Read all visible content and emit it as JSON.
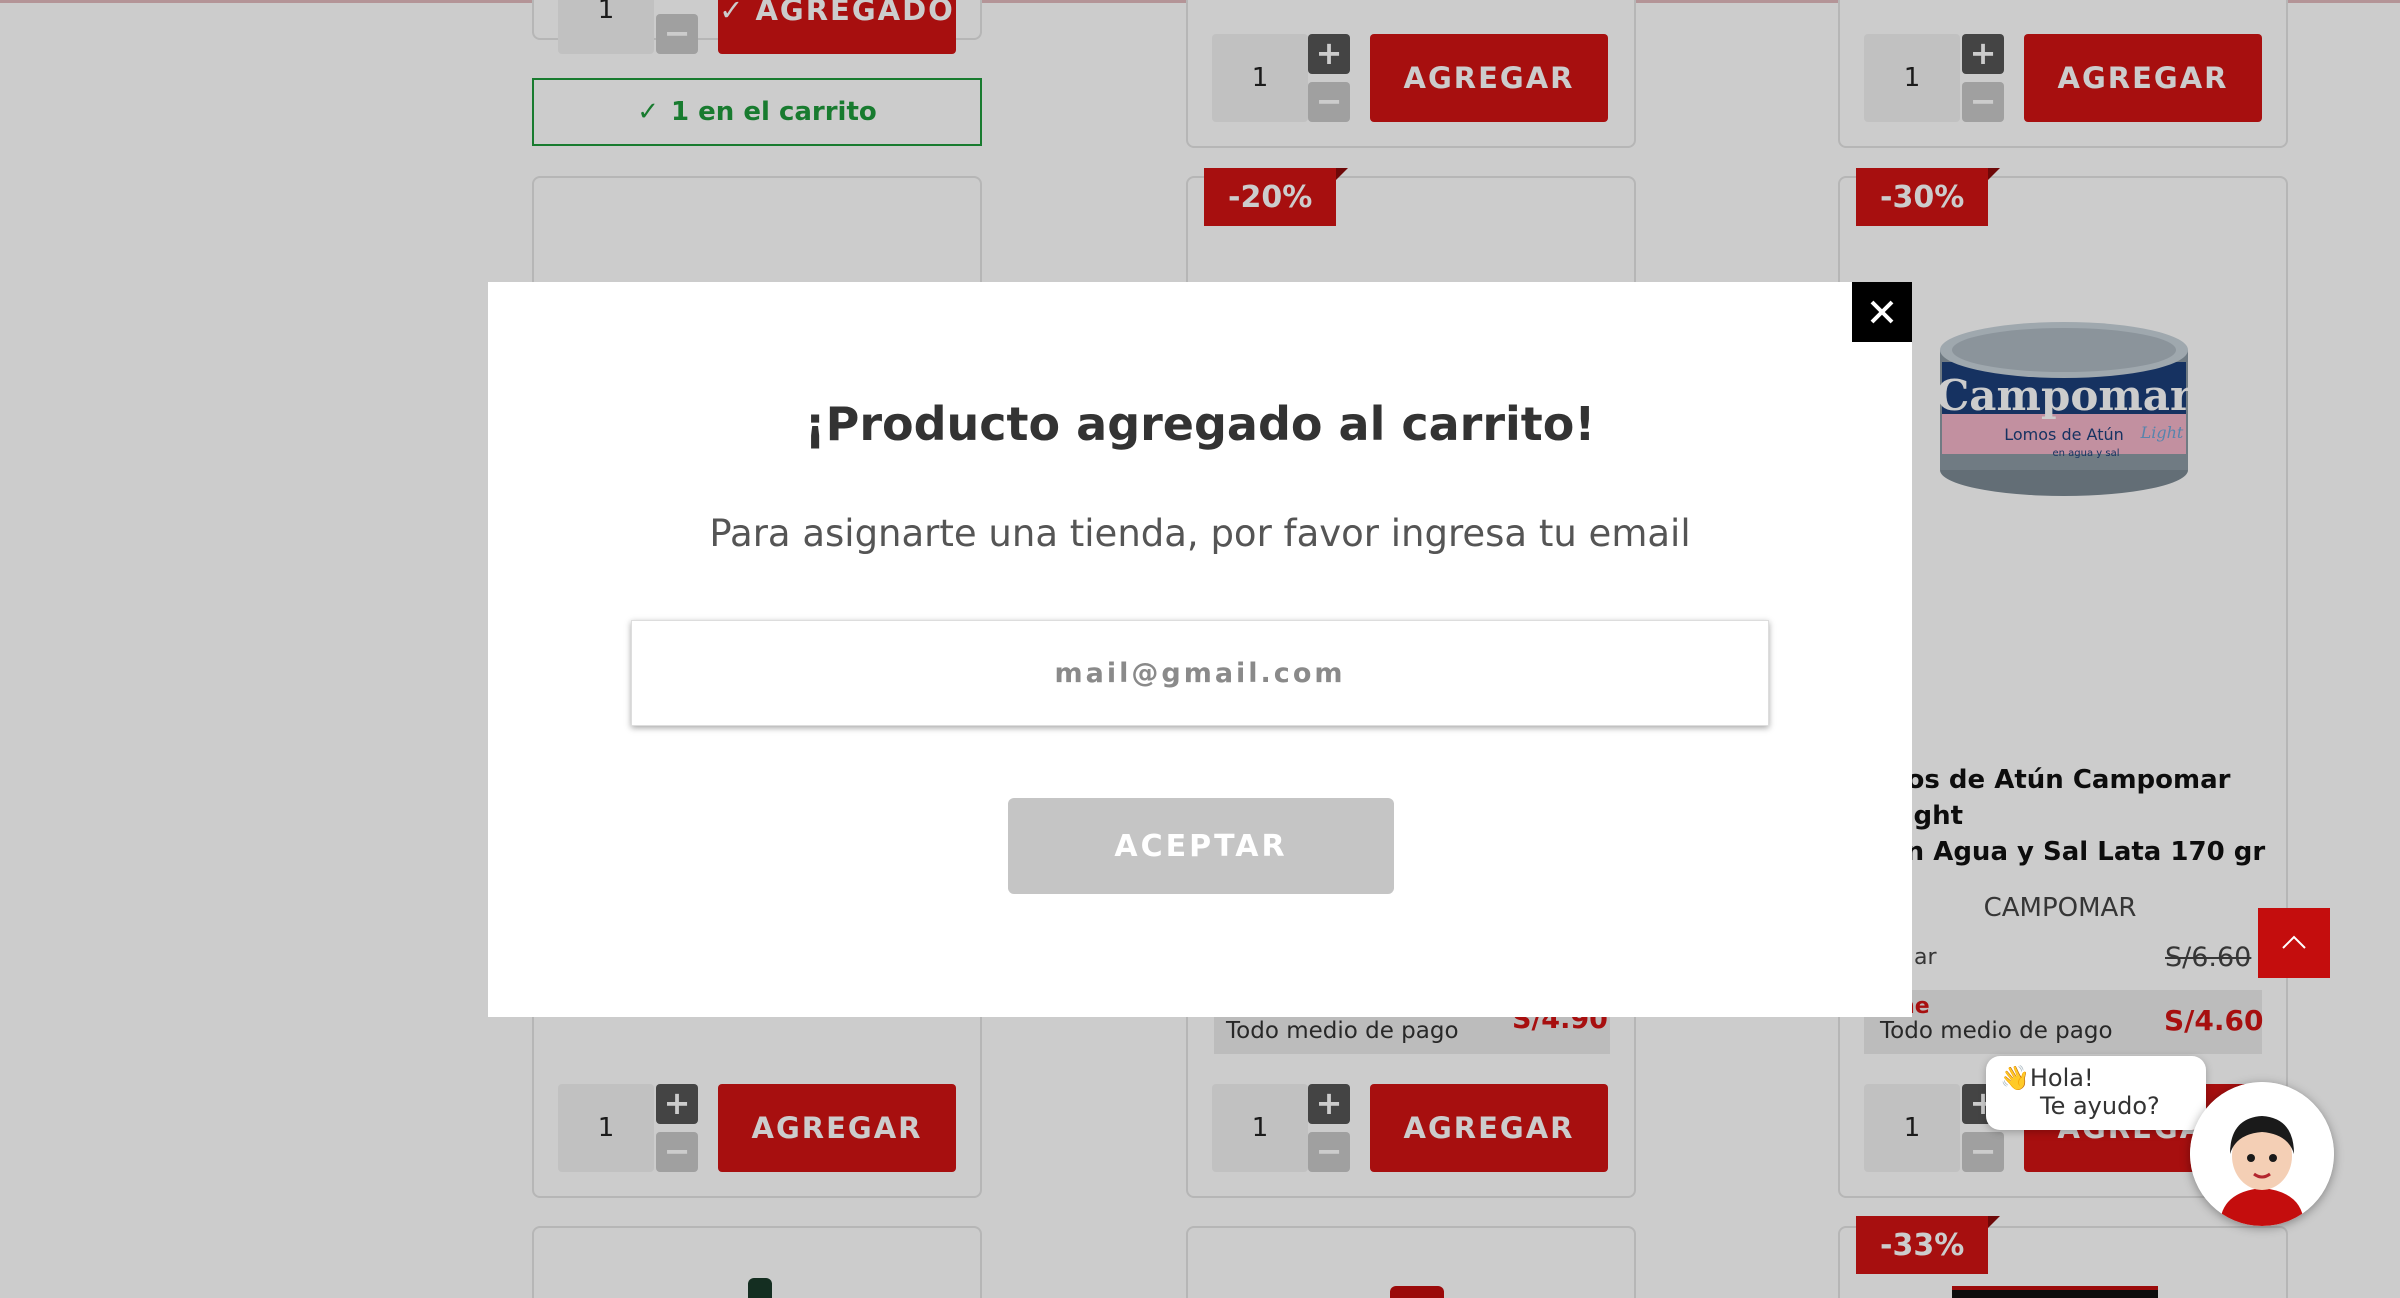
{
  "colors": {
    "accent_red": "#d11313",
    "success_green": "#1f9a3b",
    "overlay": "rgba(0,0,0,0.2)",
    "disabled_button": "#c5c5c5"
  },
  "products": {
    "row1": [
      {
        "qty": "1",
        "button": "AGREGADO",
        "in_cart": "1 en el carrito"
      },
      {
        "qty": "1",
        "button": "AGREGAR"
      },
      {
        "qty": "1",
        "button": "AGREGAR"
      }
    ],
    "row2": [
      {
        "qty": "1",
        "button": "AGREGAR"
      },
      {
        "badge": "-20%",
        "qty": "1",
        "button": "AGREGAR",
        "price_sub": "Todo medio de pago",
        "price": "S/4.90"
      },
      {
        "badge": "-30%",
        "qty": "1",
        "button": "AGREGAR",
        "name_line1": "nos de Atún Campomar Light",
        "name_line2": "en Agua y Sal Lata 170 gr",
        "brand": "CAMPOMAR",
        "regular_label": "gular",
        "regular_price": "S/6.60",
        "online_label": "line",
        "online_sub": "Todo medio de pago",
        "online_price": "S/4.60",
        "image_logo": "Campomar",
        "image_line1": "Lomos de Atún",
        "image_line2": "en agua y sal",
        "image_light": "Light"
      }
    ],
    "row3": [
      {
        "badge": "-33%"
      }
    ]
  },
  "modal": {
    "title": "¡Producto agregado al carrito!",
    "subtitle": "Para asignarte una tienda, por favor ingresa tu email",
    "email_placeholder": "mail@gmail.com",
    "email_value": "",
    "accept_label": "ACEPTAR",
    "close_icon": "close-icon"
  },
  "chat": {
    "line1": "👋Hola!",
    "line2": "Te ayudo?"
  },
  "icons": {
    "plus": "+",
    "minus": "−",
    "check": "✓"
  }
}
